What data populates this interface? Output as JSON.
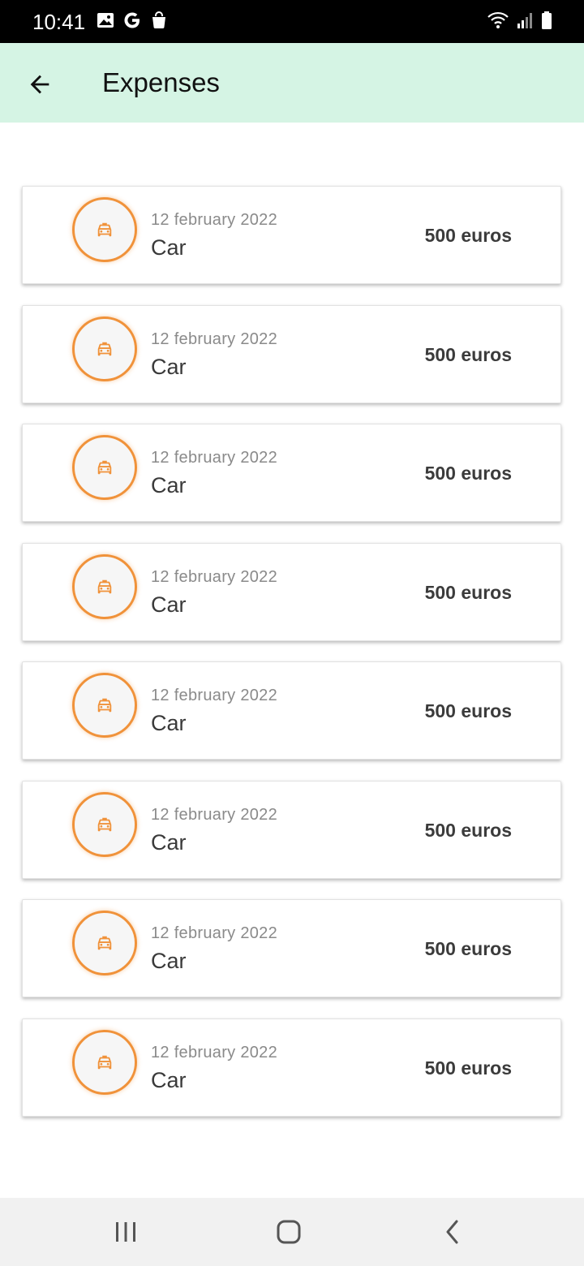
{
  "status_bar": {
    "time": "10:41",
    "left_icons": [
      "image-icon",
      "google-icon",
      "shopping-bag-icon"
    ],
    "right_icons": [
      "wifi-icon",
      "signal-icon",
      "battery-icon"
    ]
  },
  "app_bar": {
    "title": "Expenses",
    "background": "#d5f4e4"
  },
  "accent_color": "#f0923a",
  "expenses": [
    {
      "date": "12 february 2022",
      "category": "Car",
      "amount": "500 euros",
      "icon": "taxi-icon"
    },
    {
      "date": "12 february 2022",
      "category": "Car",
      "amount": "500 euros",
      "icon": "taxi-icon"
    },
    {
      "date": "12 february 2022",
      "category": "Car",
      "amount": "500 euros",
      "icon": "taxi-icon"
    },
    {
      "date": "12 february 2022",
      "category": "Car",
      "amount": "500 euros",
      "icon": "taxi-icon"
    },
    {
      "date": "12 february 2022",
      "category": "Car",
      "amount": "500 euros",
      "icon": "taxi-icon"
    },
    {
      "date": "12 february 2022",
      "category": "Car",
      "amount": "500 euros",
      "icon": "taxi-icon"
    },
    {
      "date": "12 february 2022",
      "category": "Car",
      "amount": "500 euros",
      "icon": "taxi-icon"
    },
    {
      "date": "12 february 2022",
      "category": "Car",
      "amount": "500 euros",
      "icon": "taxi-icon"
    }
  ],
  "nav_bar": {
    "buttons": [
      "recent-apps-icon",
      "home-icon",
      "back-icon"
    ]
  }
}
